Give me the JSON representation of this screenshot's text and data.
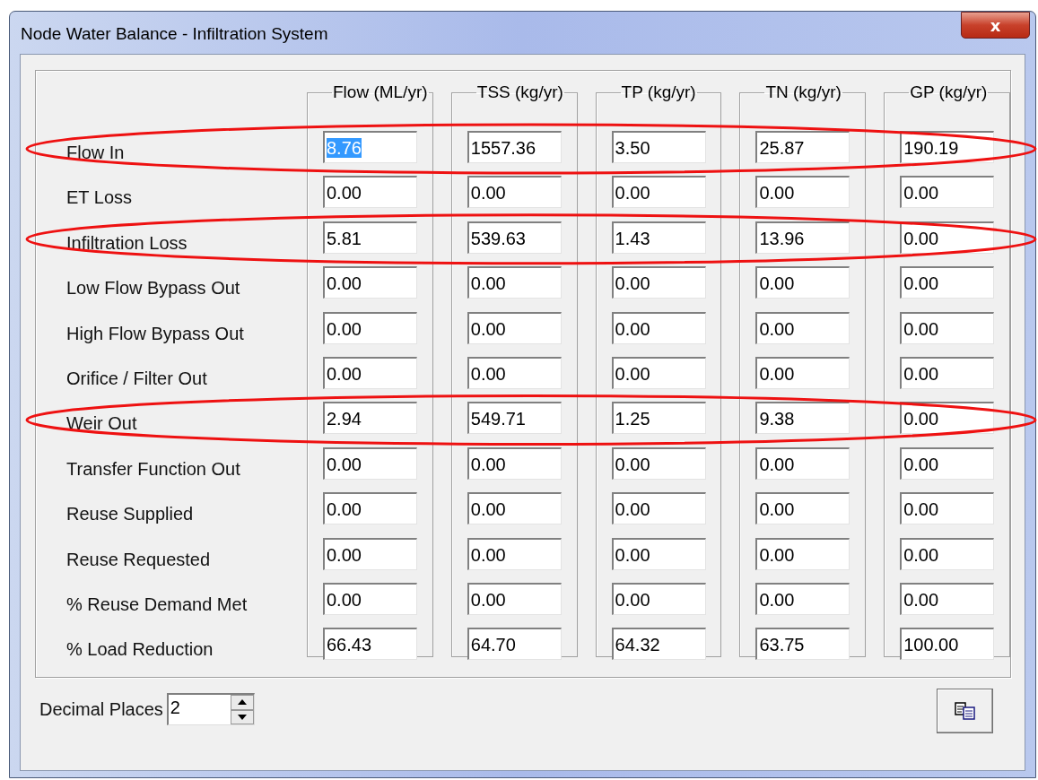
{
  "window": {
    "title": "Node Water Balance - Infiltration System",
    "close": "x"
  },
  "columns": [
    "Flow (ML/yr)",
    "TSS (kg/yr)",
    "TP (kg/yr)",
    "TN (kg/yr)",
    "GP (kg/yr)"
  ],
  "rows": [
    {
      "label": "Flow In",
      "highlighted": true,
      "values": [
        {
          "text": "8.76",
          "selected": true
        },
        {
          "text": "1557.36",
          "selected": false
        },
        {
          "text": "3.50",
          "selected": false
        },
        {
          "text": "25.87",
          "selected": false
        },
        {
          "text": "190.19",
          "selected": false
        }
      ]
    },
    {
      "label": "ET Loss",
      "highlighted": false,
      "values": [
        {
          "text": "0.00",
          "selected": false
        },
        {
          "text": "0.00",
          "selected": false
        },
        {
          "text": "0.00",
          "selected": false
        },
        {
          "text": "0.00",
          "selected": false
        },
        {
          "text": "0.00",
          "selected": false
        }
      ]
    },
    {
      "label": "Infiltration Loss",
      "highlighted": true,
      "values": [
        {
          "text": "5.81",
          "selected": false
        },
        {
          "text": "539.63",
          "selected": false
        },
        {
          "text": "1.43",
          "selected": false
        },
        {
          "text": "13.96",
          "selected": false
        },
        {
          "text": "0.00",
          "selected": false
        }
      ]
    },
    {
      "label": "Low Flow Bypass Out",
      "highlighted": false,
      "values": [
        {
          "text": "0.00",
          "selected": false
        },
        {
          "text": "0.00",
          "selected": false
        },
        {
          "text": "0.00",
          "selected": false
        },
        {
          "text": "0.00",
          "selected": false
        },
        {
          "text": "0.00",
          "selected": false
        }
      ]
    },
    {
      "label": "High Flow Bypass Out",
      "highlighted": false,
      "values": [
        {
          "text": "0.00",
          "selected": false
        },
        {
          "text": "0.00",
          "selected": false
        },
        {
          "text": "0.00",
          "selected": false
        },
        {
          "text": "0.00",
          "selected": false
        },
        {
          "text": "0.00",
          "selected": false
        }
      ]
    },
    {
      "label": "Orifice / Filter Out",
      "highlighted": false,
      "values": [
        {
          "text": "0.00",
          "selected": false
        },
        {
          "text": "0.00",
          "selected": false
        },
        {
          "text": "0.00",
          "selected": false
        },
        {
          "text": "0.00",
          "selected": false
        },
        {
          "text": "0.00",
          "selected": false
        }
      ]
    },
    {
      "label": "Weir Out",
      "highlighted": true,
      "values": [
        {
          "text": "2.94",
          "selected": false
        },
        {
          "text": "549.71",
          "selected": false
        },
        {
          "text": "1.25",
          "selected": false
        },
        {
          "text": "9.38",
          "selected": false
        },
        {
          "text": "0.00",
          "selected": false
        }
      ]
    },
    {
      "label": "Transfer Function Out",
      "highlighted": false,
      "values": [
        {
          "text": "0.00",
          "selected": false
        },
        {
          "text": "0.00",
          "selected": false
        },
        {
          "text": "0.00",
          "selected": false
        },
        {
          "text": "0.00",
          "selected": false
        },
        {
          "text": "0.00",
          "selected": false
        }
      ]
    },
    {
      "label": "Reuse Supplied",
      "highlighted": false,
      "values": [
        {
          "text": "0.00",
          "selected": false
        },
        {
          "text": "0.00",
          "selected": false
        },
        {
          "text": "0.00",
          "selected": false
        },
        {
          "text": "0.00",
          "selected": false
        },
        {
          "text": "0.00",
          "selected": false
        }
      ]
    },
    {
      "label": "Reuse Requested",
      "highlighted": false,
      "values": [
        {
          "text": "0.00",
          "selected": false
        },
        {
          "text": "0.00",
          "selected": false
        },
        {
          "text": "0.00",
          "selected": false
        },
        {
          "text": "0.00",
          "selected": false
        },
        {
          "text": "0.00",
          "selected": false
        }
      ]
    },
    {
      "label": "% Reuse Demand Met",
      "highlighted": false,
      "values": [
        {
          "text": "0.00",
          "selected": false
        },
        {
          "text": "0.00",
          "selected": false
        },
        {
          "text": "0.00",
          "selected": false
        },
        {
          "text": "0.00",
          "selected": false
        },
        {
          "text": "0.00",
          "selected": false
        }
      ]
    },
    {
      "label": "% Load Reduction",
      "highlighted": false,
      "values": [
        {
          "text": "66.43",
          "selected": false
        },
        {
          "text": "64.70",
          "selected": false
        },
        {
          "text": "64.32",
          "selected": false
        },
        {
          "text": "63.75",
          "selected": false
        },
        {
          "text": "100.00",
          "selected": false
        }
      ]
    }
  ],
  "decimal_places": {
    "label": "Decimal Places",
    "value": "2"
  }
}
